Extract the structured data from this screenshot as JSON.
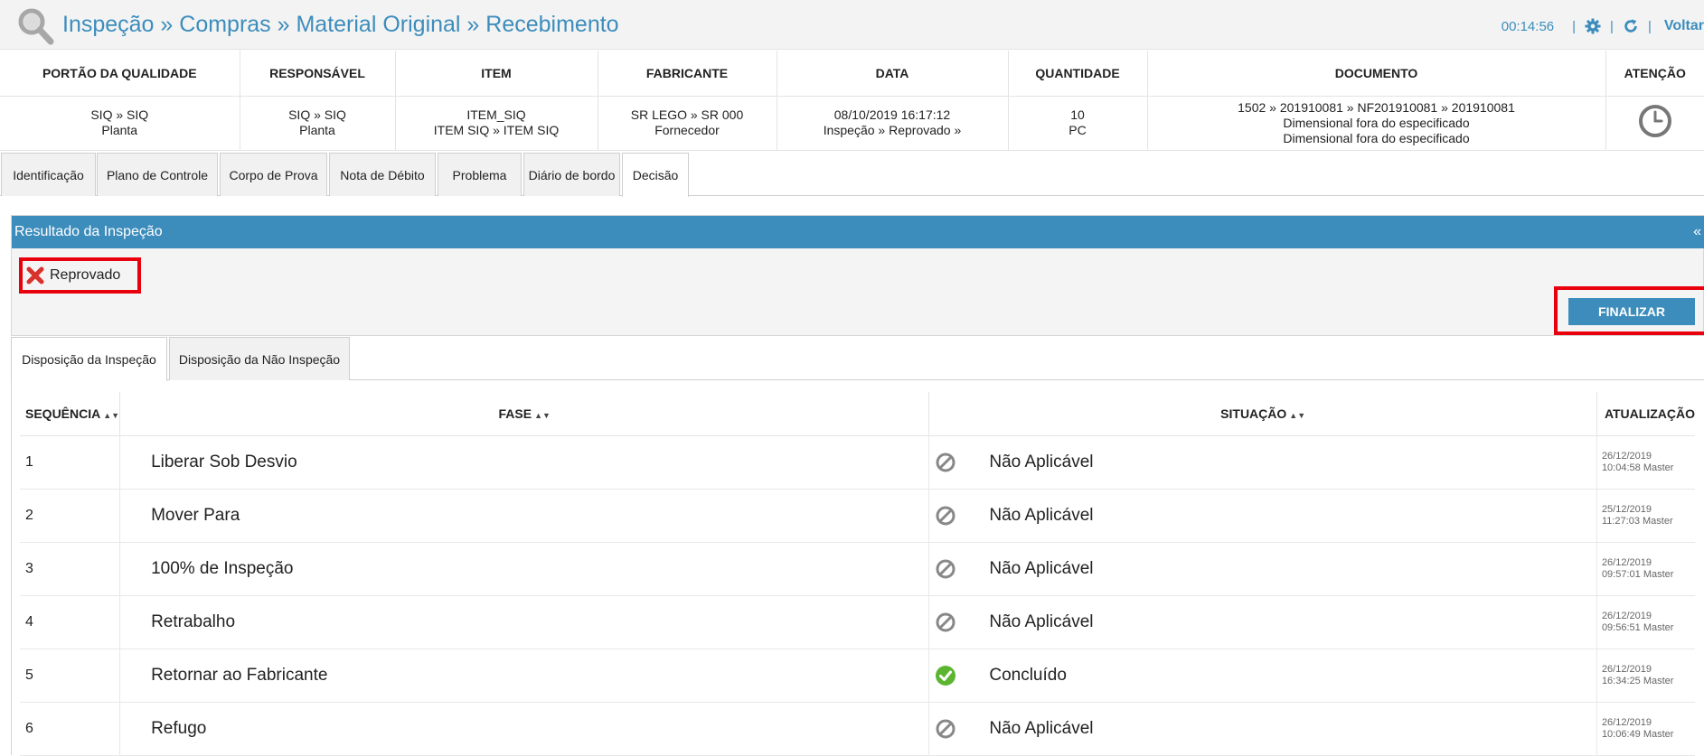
{
  "header": {
    "breadcrumb": "Inspeção » Compras » Material Original » Recebimento",
    "timer": "00:14:56",
    "back_label": "Voltar",
    "accent_color": "#3c8dbc"
  },
  "info_table": {
    "columns": [
      "PORTÃO DA QUALIDADE",
      "RESPONSÁVEL",
      "ITEM",
      "FABRICANTE",
      "DATA",
      "QUANTIDADE",
      "DOCUMENTO",
      "ATENÇÃO"
    ],
    "row": {
      "gate": [
        "SIQ » SIQ",
        "Planta"
      ],
      "responsible": [
        "SIQ » SIQ",
        "Planta"
      ],
      "item": [
        "ITEM_SIQ",
        "ITEM SIQ » ITEM SIQ"
      ],
      "manufacturer": [
        "SR LEGO » SR 000",
        "Fornecedor"
      ],
      "date": [
        "08/10/2019 16:17:12",
        "Inspeção » Reprovado »"
      ],
      "quantity": [
        "10",
        "PC"
      ],
      "document": [
        "1502 » 201910081 » NF201910081 » 201910081",
        "Dimensional fora do especificado",
        "Dimensional fora do especificado"
      ],
      "attention_icon": "clock-icon"
    }
  },
  "tabs": [
    "Identificação",
    "Plano de Controle",
    "Corpo de Prova",
    "Nota de Débito",
    "Problema",
    "Diário de bordo",
    "Decisão"
  ],
  "active_tab": "Decisão",
  "result_panel": {
    "title": "Resultado da Inspeção",
    "collapse_label": "«",
    "result_label": "Reprovado",
    "result_icon": "red-x-icon",
    "finalize_label": "FINALIZAR"
  },
  "sub_tabs": [
    "Disposição da Inspeção",
    "Disposição da Não Inspeção"
  ],
  "active_sub_tab": "Disposição da Inspeção",
  "grid": {
    "columns": [
      "SEQUÊNCIA",
      "FASE",
      "SITUAÇÃO",
      "ATUALIZAÇÃO"
    ],
    "rows": [
      {
        "seq": "1",
        "fase": "Liberar Sob Desvio",
        "situacao": "Não Aplicável",
        "icon": "not-applicable-icon",
        "date": "26/12/2019",
        "time": "10:04:58",
        "user": "Master"
      },
      {
        "seq": "2",
        "fase": "Mover Para",
        "situacao": "Não Aplicável",
        "icon": "not-applicable-icon",
        "date": "25/12/2019",
        "time": "11:27:03",
        "user": "Master"
      },
      {
        "seq": "3",
        "fase": "100% de Inspeção",
        "situacao": "Não Aplicável",
        "icon": "not-applicable-icon",
        "date": "26/12/2019",
        "time": "09:57:01",
        "user": "Master"
      },
      {
        "seq": "4",
        "fase": "Retrabalho",
        "situacao": "Não Aplicável",
        "icon": "not-applicable-icon",
        "date": "26/12/2019",
        "time": "09:56:51",
        "user": "Master"
      },
      {
        "seq": "5",
        "fase": "Retornar ao Fabricante",
        "situacao": "Concluído",
        "icon": "completed-check-icon",
        "date": "26/12/2019",
        "time": "16:34:25",
        "user": "Master"
      },
      {
        "seq": "6",
        "fase": "Refugo",
        "situacao": "Não Aplicável",
        "icon": "not-applicable-icon",
        "date": "26/12/2019",
        "time": "10:06:49",
        "user": "Master"
      }
    ]
  }
}
